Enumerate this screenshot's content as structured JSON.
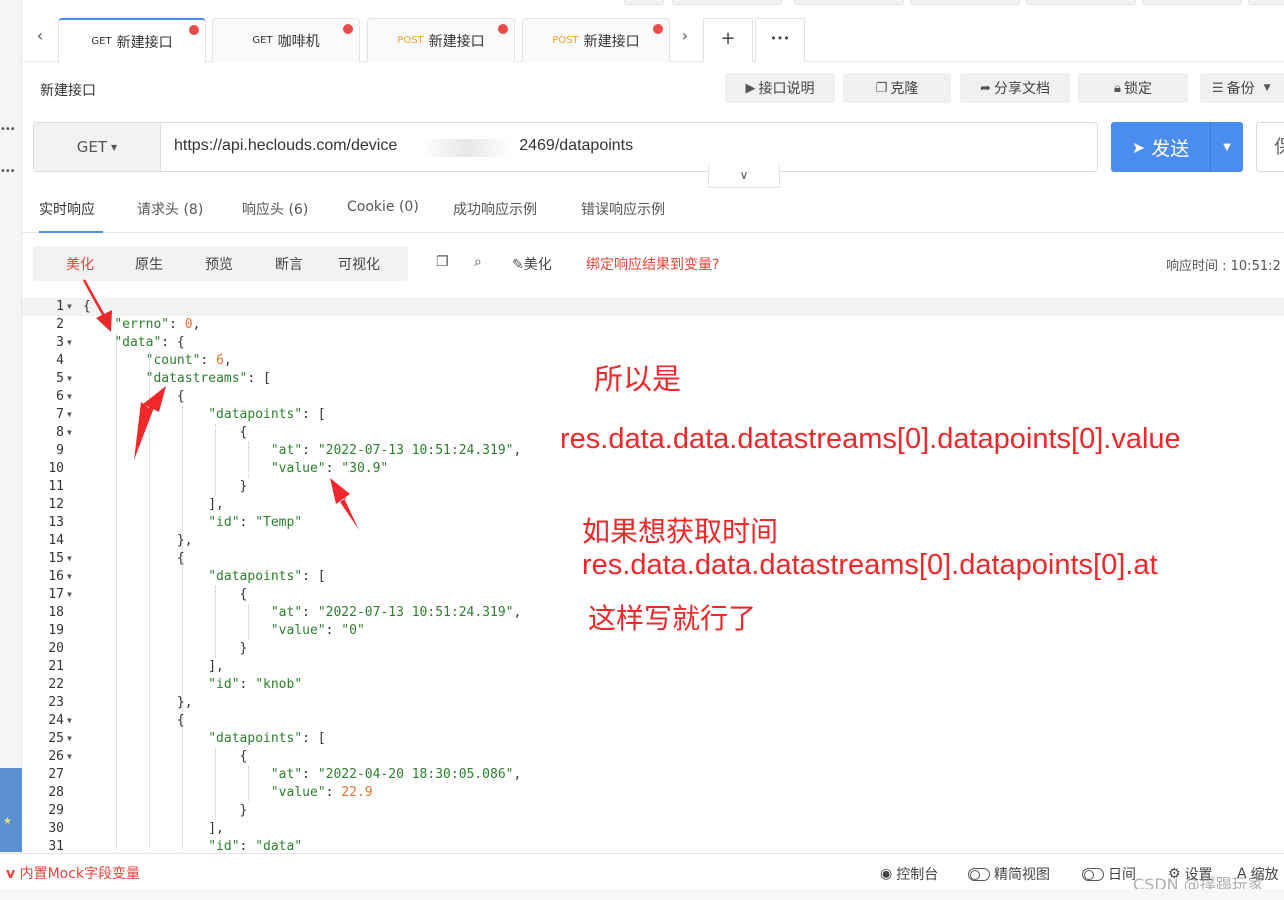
{
  "tabs": [
    {
      "method": "GET",
      "name": "新建接口",
      "modified": true,
      "active": true
    },
    {
      "method": "GET",
      "name": "咖啡机",
      "modified": true,
      "active": false
    },
    {
      "method": "POST",
      "name": "新建接口",
      "modified": true,
      "active": false
    },
    {
      "method": "POST",
      "name": "新建接口",
      "modified": true,
      "active": false
    }
  ],
  "tabbar": {
    "plus": "+",
    "more": "•••",
    "left_arrow": "‹",
    "right_arrow": "›"
  },
  "api_title": "新建接口",
  "toolbar": {
    "doc": "接口说明",
    "clone": "克隆",
    "share": "分享文档",
    "lock": "锁定",
    "backup": "备份"
  },
  "request": {
    "method": "GET",
    "url_before": "https://api.heclouds.com/device",
    "url_after": "2469/datapoints",
    "send_label": "发送",
    "save_label": "保"
  },
  "response_tabs": [
    "实时响应",
    "请求头 (8)",
    "响应头 (6)",
    "Cookie (0)",
    "成功响应示例",
    "错误响应示例"
  ],
  "view_modes": [
    "美化",
    "原生",
    "预览",
    "断言",
    "可视化"
  ],
  "view_tools": {
    "beautify": "美化",
    "bind_result": "绑定响应结果到变量?"
  },
  "response_time": "响应时间 : 10:51:2",
  "code_lines": [
    "{",
    "    \"errno\": 0,",
    "    \"data\": {",
    "        \"count\": 6,",
    "        \"datastreams\": [",
    "            {",
    "                \"datapoints\": [",
    "                    {",
    "                        \"at\": \"2022-07-13 10:51:24.319\",",
    "                        \"value\": \"30.9\"",
    "                    }",
    "                ],",
    "                \"id\": \"Temp\"",
    "            },",
    "            {",
    "                \"datapoints\": [",
    "                    {",
    "                        \"at\": \"2022-07-13 10:51:24.319\",",
    "                        \"value\": \"0\"",
    "                    }",
    "                ],",
    "                \"id\": \"knob\"",
    "            },",
    "            {",
    "                \"datapoints\": [",
    "                    {",
    "                        \"at\": \"2022-04-20 18:30:05.086\",",
    "                        \"value\": 22.9",
    "                    }",
    "                ],",
    "                \"id\": \"data\""
  ],
  "annotations": {
    "line1": "所以是",
    "line2": "res.data.data.datastreams[0].datapoints[0].value",
    "line3": "如果想获取时间",
    "line4": "res.data.data.datastreams[0].datapoints[0].at",
    "line5": "这样写就行了"
  },
  "statusbar": {
    "mock": "内置Mock字段变量",
    "console": "控制台",
    "compact": "精简视图",
    "log": "日间",
    "settings": "设置",
    "zoom": "缩放"
  },
  "watermark": "CSDN @撲蹋玩家",
  "colors": {
    "accent": "#4a8cf0",
    "annotation": "#f0282a",
    "json_key": "#2d7f2d",
    "json_number": "#e8752a",
    "active_mode": "#e8433a"
  }
}
